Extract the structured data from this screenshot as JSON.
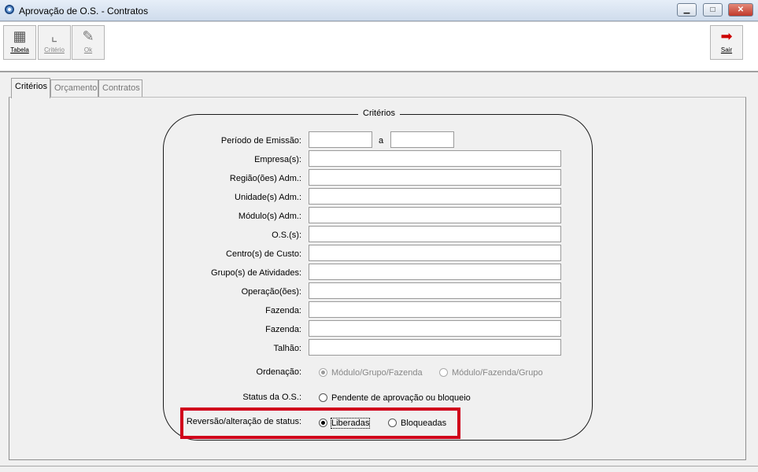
{
  "window": {
    "title": "Aprovação de O.S. - Contratos",
    "minimize_glyph": "▁",
    "maximize_glyph": "□",
    "close_glyph": "✕"
  },
  "toolbar": {
    "tabela": {
      "label": "Tabela",
      "icon": "grid-icon",
      "glyph": "▦"
    },
    "criterio": {
      "label": "Critério",
      "icon": "criteria-icon",
      "glyph": "⌞"
    },
    "ok": {
      "label": "Ok",
      "icon": "pen-icon",
      "glyph": "✎"
    },
    "sair": {
      "label": "Sair",
      "icon": "exit-door-icon",
      "glyph": "➡"
    }
  },
  "tabs": [
    {
      "label": "Critérios",
      "active": true
    },
    {
      "label": "Orçamento",
      "active": false
    },
    {
      "label": "Contratos",
      "active": false
    }
  ],
  "criteria": {
    "group_title": "Critérios",
    "periodo_label": "Período de Emissão:",
    "periodo_sep": "a",
    "periodo_start": "",
    "periodo_end": "",
    "fields": [
      {
        "label": "Empresa(s):",
        "value": ""
      },
      {
        "label": "Região(ões) Adm.:",
        "value": ""
      },
      {
        "label": "Unidade(s) Adm.:",
        "value": ""
      },
      {
        "label": "Módulo(s) Adm.:",
        "value": ""
      },
      {
        "label": "O.S.(s):",
        "value": ""
      },
      {
        "label": "Centro(s) de Custo:",
        "value": ""
      },
      {
        "label": "Grupo(s) de Atividades:",
        "value": ""
      },
      {
        "label": "Operação(ões):",
        "value": ""
      },
      {
        "label": "Fazenda:",
        "value": ""
      },
      {
        "label": "Fazenda:",
        "value": ""
      },
      {
        "label": "Talhão:",
        "value": ""
      }
    ],
    "ordenacao": {
      "label": "Ordenação:",
      "options": [
        "Módulo/Grupo/Fazenda",
        "Módulo/Fazenda/Grupo"
      ],
      "selected": 0
    },
    "status": {
      "label": "Status da O.S.:",
      "options": [
        "Pendente de aprovação ou bloqueio"
      ],
      "selected": null
    },
    "reversao": {
      "label": "Reversão/alteração de status:",
      "options": [
        "Liberadas",
        "Bloqueadas"
      ],
      "selected": 0
    }
  },
  "colors": {
    "highlight": "#d0021b"
  }
}
